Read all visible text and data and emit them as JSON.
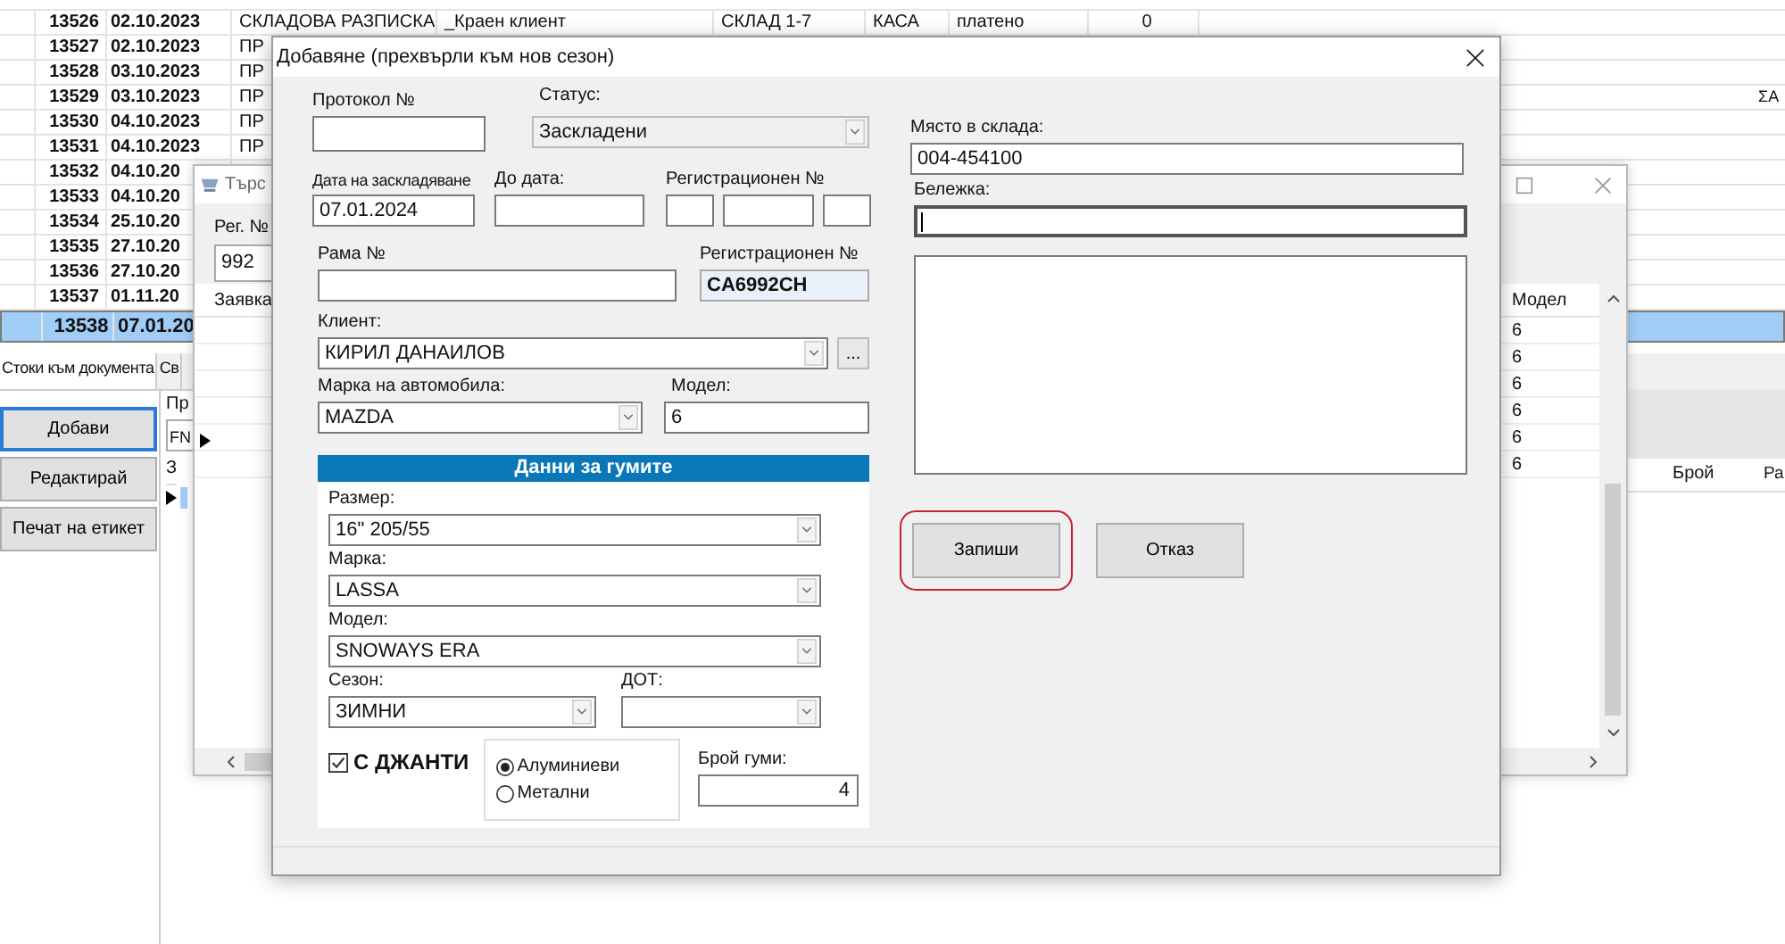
{
  "background_table": {
    "rows": [
      {
        "number": "13526",
        "date": "02.10.2023",
        "document": "СКЛАДОВА РАЗПИСКА",
        "client": "_Краен клиент",
        "warehouse": "СКЛАД 1-7",
        "payment": "КАСА",
        "status": "платено",
        "amount": "0",
        "selected": false
      },
      {
        "number": "13527",
        "date": "02.10.2023",
        "document": "ПР",
        "selected": false
      },
      {
        "number": "13528",
        "date": "03.10.2023",
        "document": "ПР",
        "selected": false
      },
      {
        "number": "13529",
        "date": "03.10.2023",
        "document": "ПР",
        "note": "ΣΑ",
        "selected": false
      },
      {
        "number": "13530",
        "date": "04.10.2023",
        "document": "ПР",
        "selected": false
      },
      {
        "number": "13531",
        "date": "04.10.2023",
        "document": "ПР",
        "selected": false
      },
      {
        "number": "13532",
        "date": "04.10.20",
        "selected": false
      },
      {
        "number": "13533",
        "date": "04.10.20",
        "selected": false
      },
      {
        "number": "13534",
        "date": "25.10.20",
        "selected": false
      },
      {
        "number": "13535",
        "date": "27.10.20",
        "selected": false
      },
      {
        "number": "13536",
        "date": "27.10.20",
        "selected": false
      },
      {
        "number": "13537",
        "date": "01.11.20",
        "selected": false
      },
      {
        "number": "13538",
        "date": "07.01.20",
        "selected": true
      }
    ]
  },
  "search_window": {
    "title": "Търс",
    "reg_label": "Рег. №",
    "reg_value": "992",
    "first_column": "Заявка",
    "model_column": "Модел",
    "model_values": [
      "6",
      "6",
      "6",
      "6",
      "6",
      "6"
    ]
  },
  "document_panel": {
    "tabs": [
      {
        "label": "Стоки към документа",
        "selected": true
      },
      {
        "label": "Св",
        "selected": false
      }
    ],
    "buttons": [
      {
        "label": "Добави",
        "focused": true
      },
      {
        "label": "Редактирай",
        "focused": false
      },
      {
        "label": "Печат на етикет",
        "focused": false
      }
    ],
    "filter_label": "Пр",
    "filter_value": "FN",
    "grid_column": "З",
    "right_columns": [
      "Брой",
      "Ра"
    ]
  },
  "dialog": {
    "title": "Добавяне (прехвърли към нов сезон)",
    "protocol": {
      "label": "Протокол №"
    },
    "status": {
      "label": "Статус:",
      "value": "Заскладени"
    },
    "store_date": {
      "label": "Дата на заскладяване",
      "value": "07.01.2024"
    },
    "to_date": {
      "label": "До дата:"
    },
    "registration_parts": {
      "label": "Регистрационен №"
    },
    "frame": {
      "label": "Рама №"
    },
    "registration": {
      "label": "Регистрационен №",
      "value": "CA6992CH"
    },
    "client": {
      "label": "Клиент:",
      "value": "КИРИЛ ДАНАИЛОВ",
      "browse": "..."
    },
    "car_make": {
      "label": "Марка на автомобила:",
      "value": "MAZDA"
    },
    "car_model": {
      "label": "Модел:",
      "value": "6"
    },
    "tires": {
      "title": "Данни за гумите",
      "size": {
        "label": "Размер:",
        "value": "16\" 205/55"
      },
      "brand": {
        "label": "Марка:",
        "value": "LASSA"
      },
      "model": {
        "label": "Модел:",
        "value": "SNOWAYS ERA"
      },
      "season": {
        "label": "Сезон:",
        "value": "ЗИМНИ"
      },
      "dot": {
        "label": "ДОТ:"
      },
      "rims": {
        "label": "С ДЖАНТИ",
        "checked": true
      },
      "rim_types": [
        {
          "label": "Алуминиеви",
          "selected": true
        },
        {
          "label": "Метални",
          "selected": false
        }
      ],
      "count": {
        "label": "Брой гуми:",
        "value": "4"
      }
    },
    "location": {
      "label": "Място в склада:",
      "value": "004-454100"
    },
    "note": {
      "label": "Бележка:",
      "focused": true
    },
    "buttons": [
      {
        "label": "Запиши",
        "highlighted": true
      },
      {
        "label": "Отказ",
        "highlighted": false
      }
    ]
  }
}
